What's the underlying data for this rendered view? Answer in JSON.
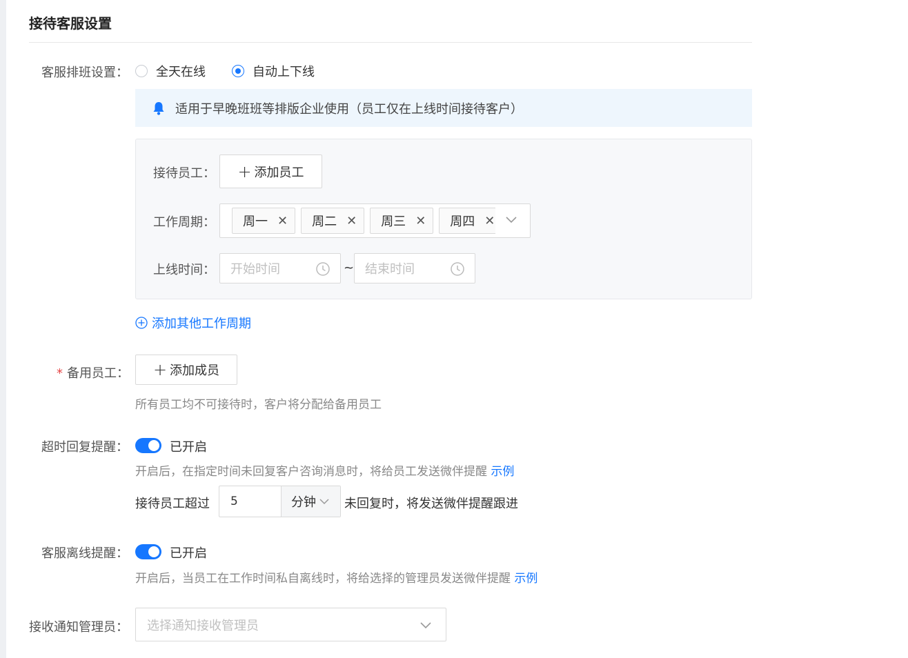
{
  "section": {
    "title": "接待客服设置"
  },
  "schedule": {
    "label": "客服排班设置：",
    "options": [
      {
        "label": "全天在线",
        "checked": false
      },
      {
        "label": "自动上下线",
        "checked": true
      }
    ],
    "notice": "适用于早晚班班等排版企业使用（员工仅在上线时间接待客户）",
    "staff_label": "接待员工：",
    "add_staff_button": "添加员工",
    "period_label": "工作周期：",
    "period_tags": [
      "周一",
      "周二",
      "周三",
      "周四"
    ],
    "online_time_label": "上线时间：",
    "start_placeholder": "开始时间",
    "range_separator": "~",
    "end_placeholder": "结束时间",
    "add_period_link": "添加其他工作周期"
  },
  "backup": {
    "required_mark": "*",
    "label": "备用员工：",
    "add_member_button": "添加成员",
    "hint": "所有员工均不可接待时，客户将分配给备用员工"
  },
  "timeout_reminder": {
    "label": "超时回复提醒：",
    "enabled": true,
    "status": "已开启",
    "hint": "开启后，在指定时间未回复客户咨询消息时，将给员工发送微伴提醒",
    "example_link": "示例",
    "prefix": "接待员工超过",
    "value": "5",
    "unit": "分钟",
    "suffix": "未回复时，将发送微伴提醒跟进"
  },
  "offline_reminder": {
    "label": "客服离线提醒：",
    "enabled": true,
    "status": "已开启",
    "hint": "开启后，当员工在工作时间私自离线时，将给选择的管理员发送微伴提醒",
    "example_link": "示例"
  },
  "notify_admin": {
    "label": "接收通知管理员：",
    "placeholder": "选择通知接收管理员"
  },
  "colors": {
    "accent": "#1677ff",
    "required": "#e54545",
    "notice_bg": "#eef6fd"
  }
}
